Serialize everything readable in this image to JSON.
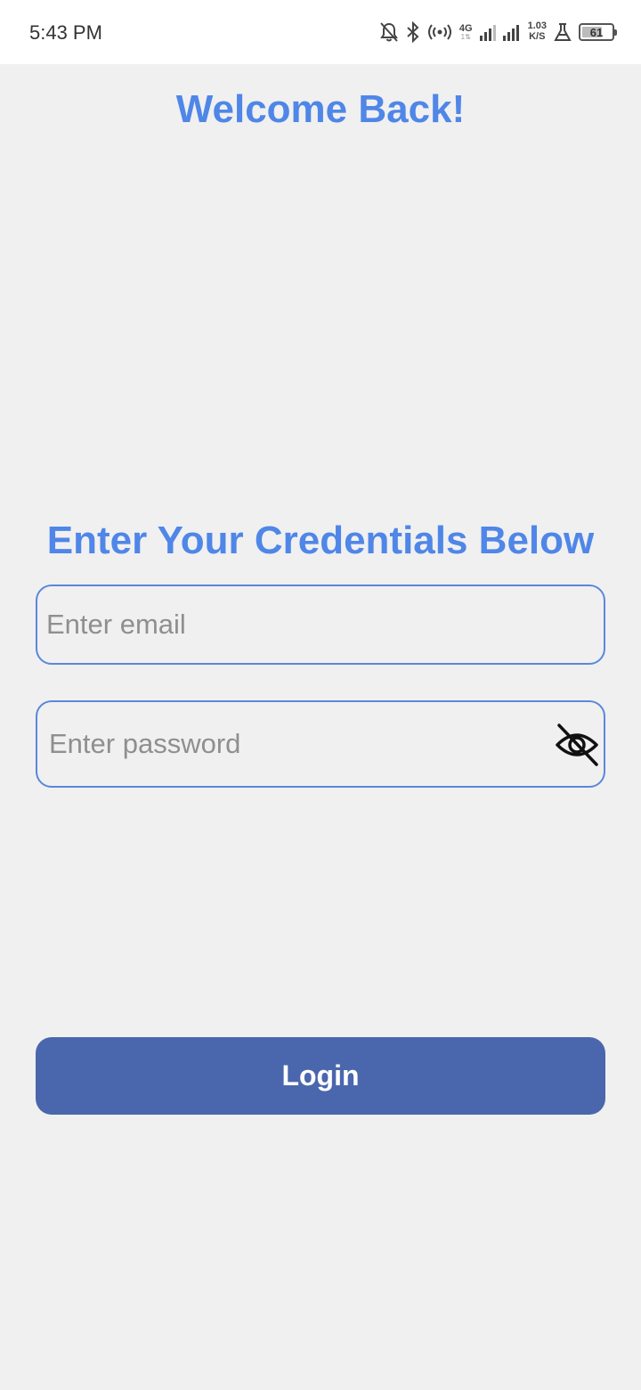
{
  "status_bar": {
    "time": "5:43 PM",
    "network_type": "4G",
    "network_sub": "1⇅",
    "speed_value": "1.03",
    "speed_unit": "K/S",
    "battery_level": "61",
    "icons": [
      "bell-off-icon",
      "bluetooth-icon",
      "hotspot-icon",
      "signal-icon",
      "signal-icon",
      "lab-flask-icon",
      "battery-icon"
    ]
  },
  "header": {
    "title": "Welcome Back!"
  },
  "form": {
    "subtitle": "Enter Your Credentials Below",
    "email": {
      "value": "",
      "placeholder": "Enter email"
    },
    "password": {
      "value": "",
      "placeholder": "Enter password",
      "toggle_icon": "eye-off-icon"
    },
    "login_label": "Login"
  },
  "colors": {
    "accent": "#4f86e8",
    "button": "#4a67ad",
    "field_border": "#5b87dc",
    "background": "#f0f0f0"
  }
}
